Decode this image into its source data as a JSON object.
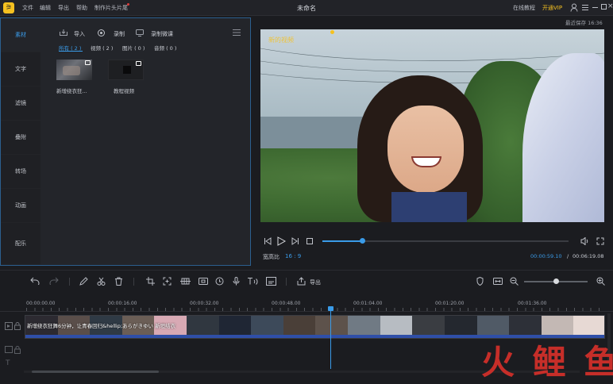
{
  "titlebar": {
    "logo": "⚞",
    "menus": [
      "文件",
      "编辑",
      "导出",
      "帮助",
      "制作片头片尾"
    ],
    "doc_title": "未命名",
    "tutorial": "在线教程",
    "vip": "开通VIP",
    "autosave": "最近保存 16:36"
  },
  "sidebar": {
    "items": [
      "素材",
      "文字",
      "滤镜",
      "叠附",
      "转场",
      "动画",
      "配乐"
    ]
  },
  "media": {
    "import_label": "导入",
    "record_label": "录制",
    "record_mic_label": "录制微课",
    "filters": [
      "所有 ( 2 )",
      "视频 ( 2 )",
      "图片 ( 0 )",
      "音频 ( 0 )"
    ],
    "items": [
      {
        "name": "新增绕衣狂..."
      },
      {
        "name": "教程视频"
      }
    ]
  },
  "preview": {
    "watermark": "新的视频",
    "aspect_label": "宽高比",
    "aspect_value": "16 : 9",
    "time_current": "00:00:59.10",
    "time_sep": "/",
    "time_total": "00:06:19.08",
    "progress": 0.16
  },
  "toolbar": {
    "export_label": "导出",
    "zoom": 0.5
  },
  "timeline": {
    "ruler": [
      "00:00:00.00",
      "00:00:16.00",
      "00:00:32.00",
      "00:00:48.00",
      "00:01:04.00",
      "00:01:20.00",
      "00:01:36.00"
    ],
    "clip_title": "新增绕衣狂舞6分钟，让青春回归&hellip;あらがきゆい 新垣结衣"
  },
  "watermark": {
    "text": "火 鲤 鱼"
  },
  "colors": {
    "accent": "#3a9be8",
    "vip": "#f5c120",
    "brand_red": "#d9302a"
  }
}
